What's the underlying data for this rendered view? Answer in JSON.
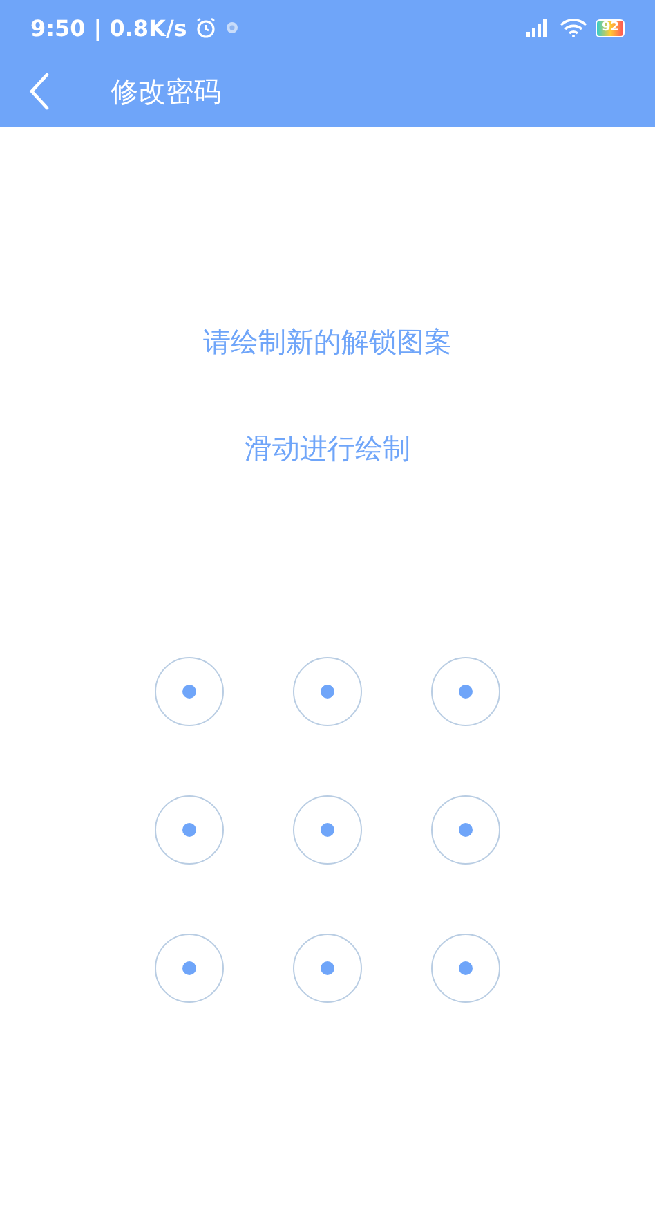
{
  "status_bar": {
    "time": "9:50",
    "speed": "| 0.8K/s",
    "battery": "92"
  },
  "app_bar": {
    "title": "修改密码"
  },
  "prompt": {
    "title": "请绘制新的解锁图案",
    "hint": "滑动进行绘制"
  },
  "pattern_nodes": [
    {
      "kind": "dot"
    },
    {
      "kind": "dot"
    },
    {
      "kind": "dot"
    },
    {
      "kind": "dot"
    },
    {
      "kind": "dot"
    },
    {
      "kind": "dot"
    },
    {
      "kind": "dot"
    },
    {
      "kind": "dot"
    },
    {
      "kind": "dot"
    }
  ]
}
